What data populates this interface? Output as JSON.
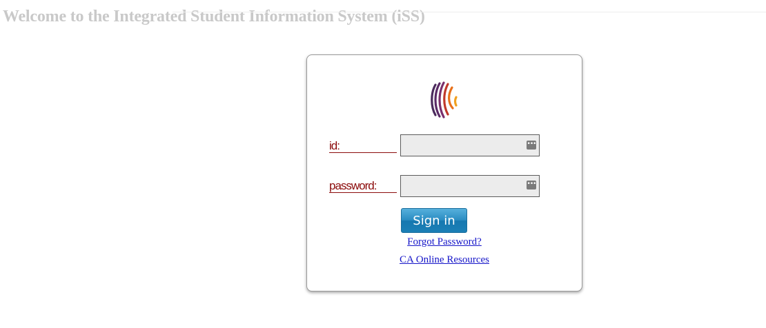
{
  "page": {
    "title": "Welcome to the Integrated Student Information System (iSS)"
  },
  "login": {
    "logo_icon": "ribbon-arcs-logo",
    "id_label": "id:",
    "id_value": "",
    "password_label": "password:",
    "password_value": "",
    "field_icon": "password-manager-key-icon",
    "signin_label": "Sign in",
    "forgot_label": "Forgot Password?",
    "resources_label": "CA Online Resources"
  },
  "colors": {
    "label": "#8b0a0a",
    "link": "#1414c8",
    "button": "#2a8cc2",
    "title": "#c9c9c9",
    "field_bg": "#ececec"
  }
}
